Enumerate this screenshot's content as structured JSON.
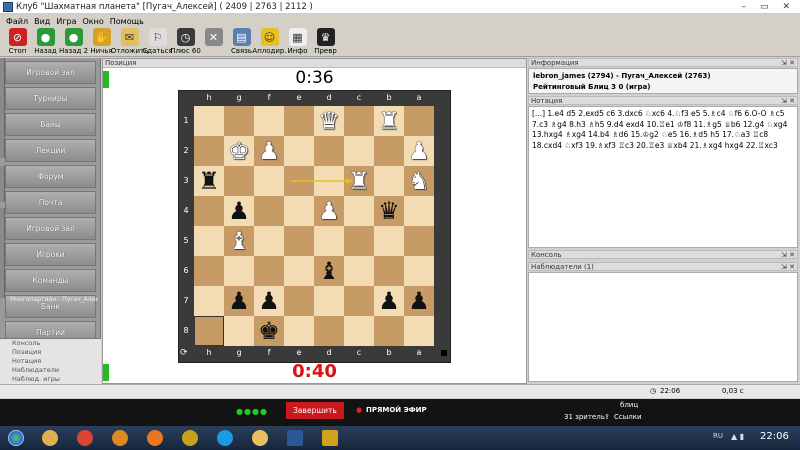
{
  "window": {
    "title": "Клуб \"Шахматная планета\" [Пугач_Алексей] ( 2409 | 2763 | 2112 )",
    "controls": [
      "–",
      "▭",
      "✕"
    ]
  },
  "menu": [
    "Файл",
    "Вид",
    "Игра",
    "Окно",
    "Помощь"
  ],
  "toolbar": [
    {
      "label": "Стоп",
      "color": "#cc2222",
      "glyph": "⊘",
      "icon": "stop-icon"
    },
    {
      "label": "Назад",
      "color": "#2a9a3a",
      "glyph": "●",
      "icon": "back-icon"
    },
    {
      "label": "Назад 2",
      "color": "#2a9a3a",
      "glyph": "●",
      "icon": "back2-icon"
    },
    {
      "label": "Ничья",
      "color": "#d6a12a",
      "glyph": "✋",
      "icon": "draw-icon"
    },
    {
      "label": "Отложить",
      "color": "#e0c060",
      "glyph": "✉",
      "icon": "adjourn-icon"
    },
    {
      "label": "Сдаться",
      "color": "#dddddd",
      "glyph": "⚐",
      "icon": "resign-icon"
    },
    {
      "label": "Плюс 60",
      "color": "#3a3a3a",
      "glyph": "◷",
      "icon": "clock-icon"
    },
    {
      "label": "",
      "color": "#888888",
      "glyph": "✕",
      "icon": "abort-icon"
    },
    {
      "label": "Связь",
      "color": "#5a7fb0",
      "glyph": "▤",
      "icon": "connection-icon"
    },
    {
      "label": "Аплодир.",
      "color": "#e8c020",
      "glyph": "☺",
      "icon": "applause-icon"
    },
    {
      "label": "Инфо",
      "color": "#eeeeee",
      "glyph": "▦",
      "icon": "info-icon"
    },
    {
      "label": "Превр",
      "color": "#222222",
      "glyph": "♛",
      "icon": "promote-icon"
    }
  ],
  "sidebar": {
    "items": [
      "Игровой зал",
      "Турниры",
      "Баны",
      "Лекции",
      "Форум",
      "Почта",
      "Игровой зал",
      "Игроки",
      "Команды",
      "Банк",
      "Партии"
    ],
    "sub": "Многопартийн - Пугач_Алексей",
    "bottom": [
      "Консоль",
      "Позиция",
      "Нотация",
      "Наблюдатели",
      "Наблюд. игры"
    ]
  },
  "position": {
    "header": "Позиция",
    "top_clock": "0:36",
    "bottom_clock": "0:40"
  },
  "board": {
    "files": [
      "h",
      "g",
      "f",
      "e",
      "d",
      "c",
      "b",
      "a"
    ],
    "ranks": [
      "1",
      "2",
      "3",
      "4",
      "5",
      "6",
      "7",
      "8"
    ],
    "pieces": [
      {
        "sq": "d1",
        "p": "♛",
        "c": "w"
      },
      {
        "sq": "b1",
        "p": "♜",
        "c": "w"
      },
      {
        "sq": "g2",
        "p": "♚",
        "c": "w"
      },
      {
        "sq": "f2",
        "p": "♟",
        "c": "w"
      },
      {
        "sq": "a2",
        "p": "♟",
        "c": "w"
      },
      {
        "sq": "h3",
        "p": "♜",
        "c": "b"
      },
      {
        "sq": "c3",
        "p": "♜",
        "c": "w"
      },
      {
        "sq": "a3",
        "p": "♞",
        "c": "w"
      },
      {
        "sq": "g4",
        "p": "♟",
        "c": "b"
      },
      {
        "sq": "d4",
        "p": "♟",
        "c": "w"
      },
      {
        "sq": "b4",
        "p": "♛",
        "c": "b"
      },
      {
        "sq": "g5",
        "p": "♝",
        "c": "w"
      },
      {
        "sq": "d6",
        "p": "♝",
        "c": "b"
      },
      {
        "sq": "g7",
        "p": "♟",
        "c": "b"
      },
      {
        "sq": "f7",
        "p": "♟",
        "c": "b"
      },
      {
        "sq": "b7",
        "p": "♟",
        "c": "b"
      },
      {
        "sq": "a7",
        "p": "♟",
        "c": "b"
      },
      {
        "sq": "f8",
        "p": "♚",
        "c": "b"
      }
    ]
  },
  "info": {
    "header": "Информация",
    "players": "lebron_james (2794) - Пугач_Алексей (2763)",
    "game": "Рейтинговый Блиц 3 0  (игра)"
  },
  "notation": {
    "header": "Нотация",
    "text": "[...] 1.e4 d5 2.exd5 c6 3.dxc6 ♘xc6 4.♘f3 e5 5.♗c4 ♘f6 6.O-O ♗c5 7.c3 ♗g4 8.h3 ♗h5 9.d4 exd4 10.♖e1 ♔f8 11.♗g5 ♕b6 12.g4 ♘xg4 13.hxg4 ♗xg4 14.b4 ♗d6 15.♔g2 ♘e5 16.♗d5 h5 17.♘a3 ♖c8 18.cxd4 ♘xf3 19.♗xf3 ♖c3 20.♖e3 ♕xb4 21.♗xg4 hxg4 22.♖xc3"
  },
  "console": {
    "header": "Консоль"
  },
  "observers": {
    "header": "Наблюдатели (1)"
  },
  "status": {
    "time": "22:06",
    "value": "0,03 с"
  },
  "stream": {
    "button": "Завершить",
    "live": "ПРЯМОЙ ЭФИР",
    "mode": "блиц",
    "viewers": "31 зритель",
    "links": "Ссылки"
  },
  "taskbar": {
    "clock": "22:06",
    "lang": "RU",
    "apps": [
      {
        "icon": "explorer-icon",
        "color": "#e0b050"
      },
      {
        "icon": "chrome-icon",
        "color": "#dd4433"
      },
      {
        "icon": "media-icon",
        "color": "#dd8822"
      },
      {
        "icon": "firefox-icon",
        "color": "#e87722"
      },
      {
        "icon": "winamp-icon",
        "color": "#c8a020"
      },
      {
        "icon": "skype-icon",
        "color": "#1a9be0"
      },
      {
        "icon": "folder-icon",
        "color": "#e8c060"
      },
      {
        "icon": "word-icon",
        "color": "#2b5797"
      },
      {
        "icon": "chess-icon",
        "color": "#d0a020"
      }
    ]
  }
}
